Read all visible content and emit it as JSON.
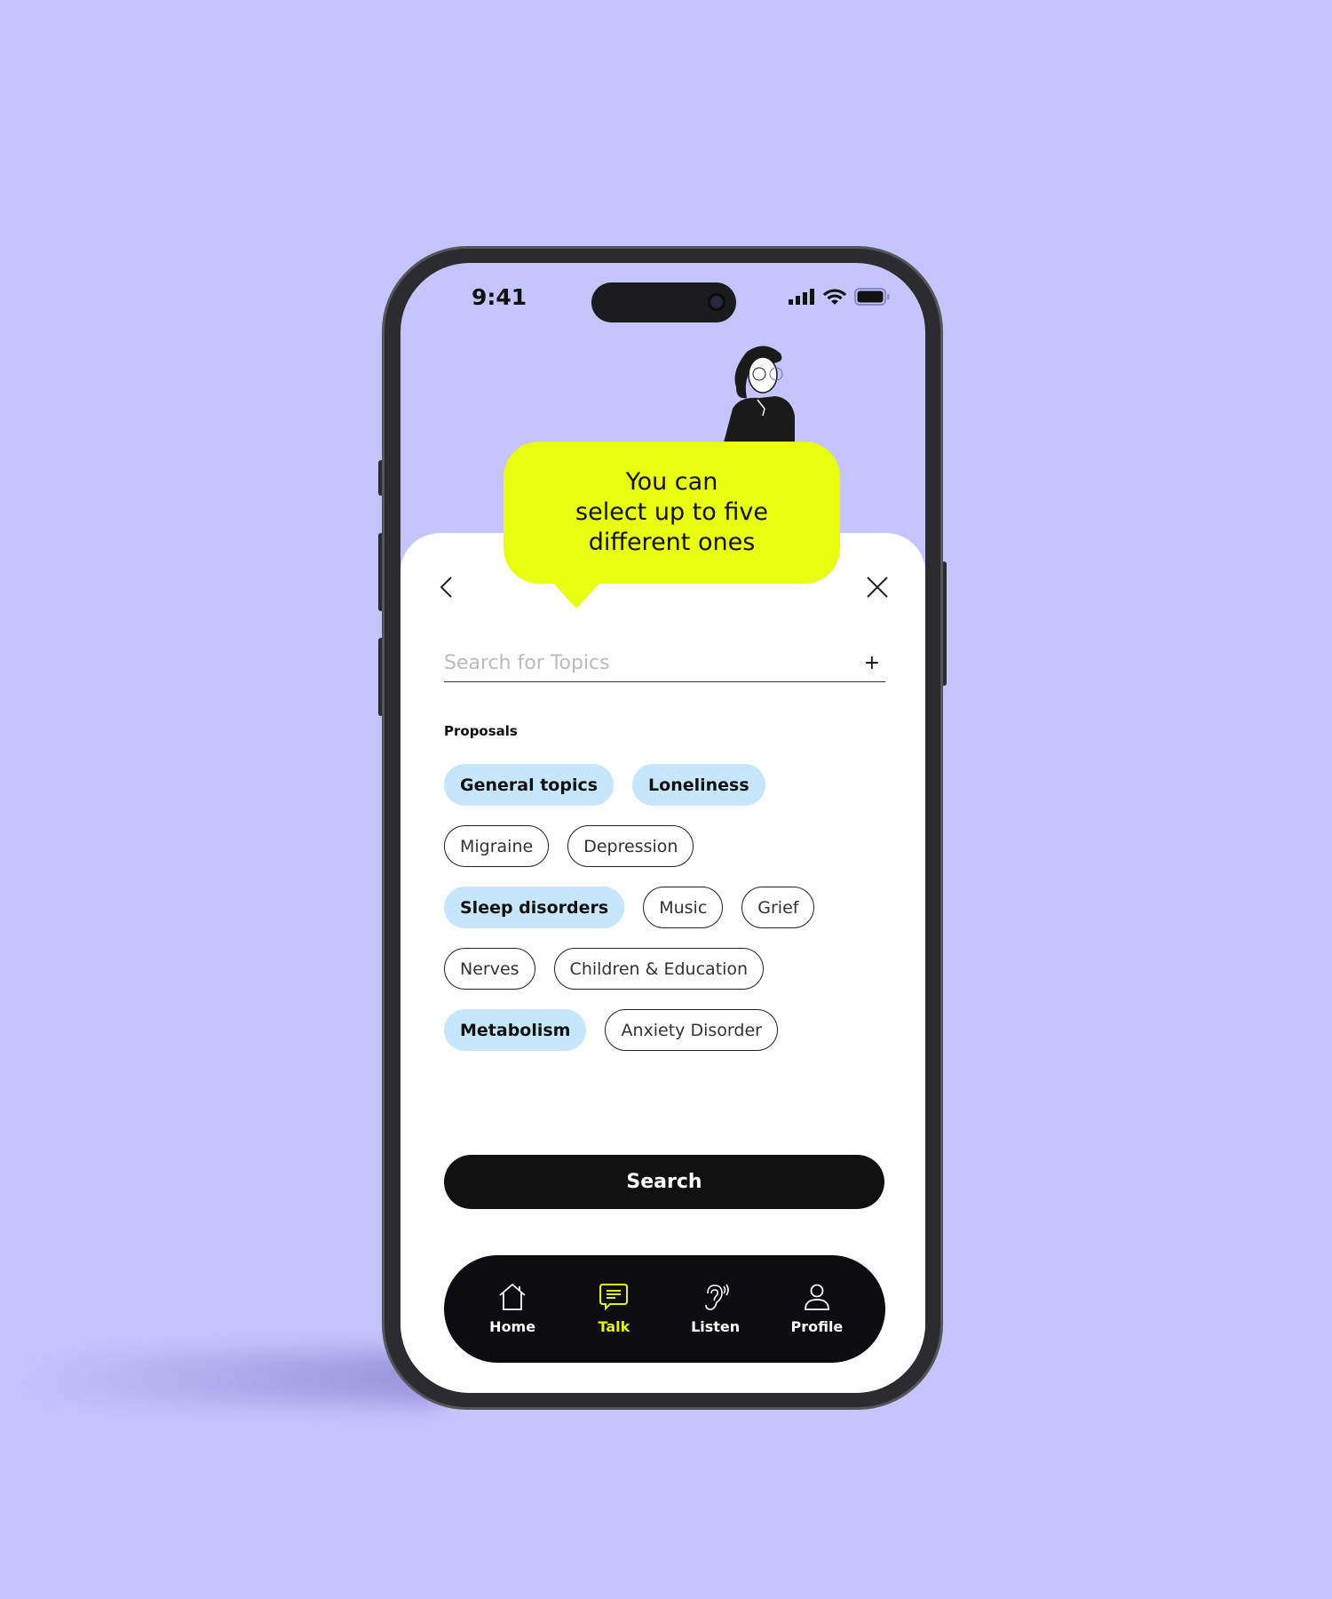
{
  "status_bar": {
    "time": "9:41"
  },
  "tooltip": {
    "lines": [
      "You can",
      "select up to five",
      "different ones"
    ]
  },
  "search": {
    "placeholder": "Search for Topics",
    "value": "",
    "add_label": "+"
  },
  "proposals": {
    "label": "Proposals",
    "chips": [
      {
        "label": "General topics",
        "selected": true
      },
      {
        "label": "Loneliness",
        "selected": true
      },
      {
        "label": "Migraine",
        "selected": false
      },
      {
        "label": "Depression",
        "selected": false
      },
      {
        "label": "Sleep disorders",
        "selected": true
      },
      {
        "label": "Music",
        "selected": false
      },
      {
        "label": "Grief",
        "selected": false
      },
      {
        "label": "Nerves",
        "selected": false
      },
      {
        "label": "Children & Education",
        "selected": false
      },
      {
        "label": "Metabolism",
        "selected": true
      },
      {
        "label": "Anxiety Disorder",
        "selected": false
      }
    ]
  },
  "search_button": {
    "label": "Search"
  },
  "nav": {
    "items": [
      {
        "label": "Home",
        "icon": "home-icon",
        "active": false
      },
      {
        "label": "Talk",
        "icon": "chat-icon",
        "active": true
      },
      {
        "label": "Listen",
        "icon": "ear-icon",
        "active": false
      },
      {
        "label": "Profile",
        "icon": "user-icon",
        "active": false
      }
    ]
  },
  "colors": {
    "background": "#c5c5fd",
    "accent": "#e9ff12",
    "chip_selected": "#c6e7fb",
    "nav_active": "#e2f50f"
  }
}
